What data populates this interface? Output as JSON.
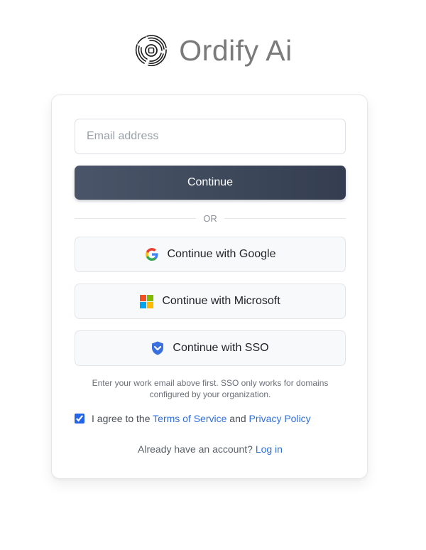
{
  "brand": {
    "name": "Ordify Ai",
    "logo_icon": "swirl-shutter-logo"
  },
  "form": {
    "email_placeholder": "Email address",
    "email_value": "",
    "continue_label": "Continue",
    "divider_label": "OR"
  },
  "social": {
    "google_label": "Continue with Google",
    "google_icon": "google-icon",
    "microsoft_label": "Continue with Microsoft",
    "microsoft_icon": "microsoft-icon",
    "sso_label": "Continue with SSO",
    "sso_icon": "shield-icon"
  },
  "sso_note": {
    "line1": "Enter your work email above first. SSO only works for domains",
    "line2": "configured by your organization."
  },
  "agreement": {
    "checked": true,
    "prefix": "I agree to the",
    "terms_link": "Terms of Service",
    "conjunction": "and",
    "privacy_link": "Privacy Policy"
  },
  "login": {
    "prompt": "Already have an account?",
    "link": "Log in"
  },
  "colors": {
    "primary_button": "#3e4759",
    "link": "#2f6fdc",
    "checkbox": "#2563eb"
  }
}
